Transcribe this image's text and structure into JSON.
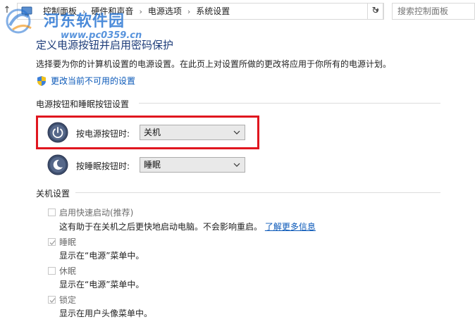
{
  "address_bar": {
    "breadcrumbs": [
      "控制面板",
      "硬件和声音",
      "电源选项",
      "系统设置"
    ],
    "search_placeholder": "搜索控制面板"
  },
  "watermark": {
    "name": "河东软件园",
    "url": "www.pc0359.cn"
  },
  "page": {
    "title": "定义电源按钮并启用密码保护",
    "description": "选择要为你的计算机设置的电源设置。在此页上对设置所做的更改将应用于你所有的电源计划。",
    "change_link": "更改当前不可用的设置"
  },
  "power_section": {
    "title": "电源按钮和睡眠按钮设置",
    "rows": [
      {
        "label": "按电源按钮时:",
        "value": "关机"
      },
      {
        "label": "按睡眠按钮时:",
        "value": "睡眠"
      }
    ]
  },
  "shutdown_section": {
    "title": "关机设置",
    "options": [
      {
        "label": "启用快速启动(推荐)",
        "checked": false,
        "desc": "这有助于在关机之后更快地启动电脑。不会影响重启。",
        "link": "了解更多信息"
      },
      {
        "label": "睡眠",
        "checked": true,
        "desc": "显示在“电源”菜单中。"
      },
      {
        "label": "休眠",
        "checked": false,
        "desc": "显示在“电源”菜单中。"
      },
      {
        "label": "锁定",
        "checked": true,
        "desc": "显示在用户头像菜单中。"
      }
    ]
  },
  "colors": {
    "highlight_border": "#e0161f",
    "link": "#0a58b8",
    "title": "#1e3d7a",
    "watermark": "#1f6fd1"
  }
}
